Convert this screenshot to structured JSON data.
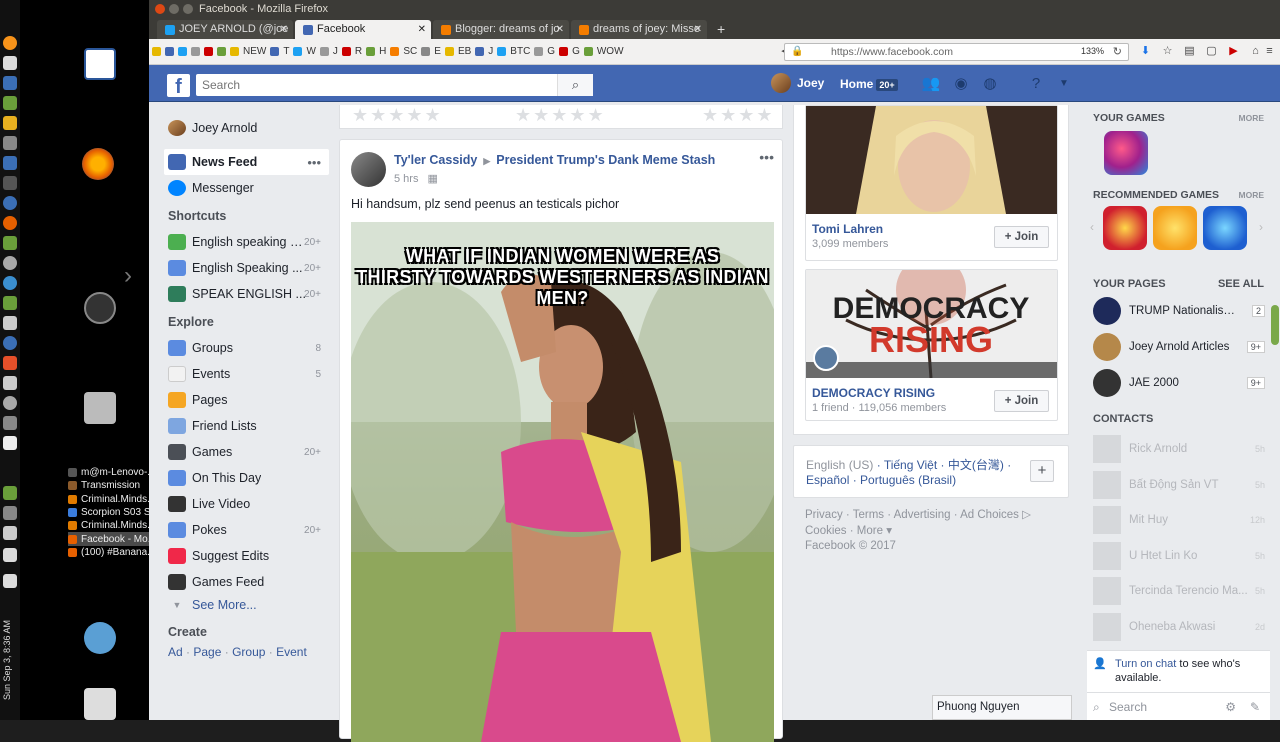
{
  "window": {
    "title": "Facebook - Mozilla Firefox"
  },
  "tabs": [
    {
      "label": "JOEY ARNOLD (@joe",
      "color": "#1da1f2"
    },
    {
      "label": "Facebook",
      "color": "#4267b2"
    },
    {
      "label": "Blogger: dreams of jo",
      "color": "#f57d00"
    },
    {
      "label": "dreams of joey: Misse",
      "color": "#f57d00"
    }
  ],
  "bookmarks": [
    "NEW",
    "T",
    "W",
    "J",
    "R",
    "H",
    "SC",
    "E",
    "EB",
    "J",
    "BTC",
    "G",
    "G",
    "WOW"
  ],
  "url": {
    "value": "https://www.facebook.com",
    "zoom": "133%"
  },
  "taskbar": [
    {
      "label": "m@m-Lenovo-...",
      "color": "#555"
    },
    {
      "label": "Transmission",
      "color": "#8b5a2b"
    },
    {
      "label": "Criminal.Minds...",
      "color": "#e07b00"
    },
    {
      "label": "Scorpion S03 S...",
      "color": "#3b7ddd"
    },
    {
      "label": "Criminal.Minds...",
      "color": "#e07b00"
    },
    {
      "label": "Facebook - Mo...",
      "color": "#e66000"
    },
    {
      "label": "(100) #Banana...",
      "color": "#e66000"
    }
  ],
  "clock": "Sun Sep 3, 8:36 AM",
  "fb": {
    "search_placeholder": "Search",
    "user_name": "Joey",
    "home_label": "Home",
    "home_badge": "20+"
  },
  "leftnav": {
    "profile": "Joey Arnold",
    "news_feed": "News Feed",
    "messenger": "Messenger",
    "shortcuts_head": "Shortcuts",
    "shortcuts": [
      {
        "label": "English speaking g...",
        "count": "20+",
        "color": "#4caf50"
      },
      {
        "label": "English Speaking ...",
        "count": "20+",
        "color": "#5b8be0"
      },
      {
        "label": "SPEAK ENGLISH ...",
        "count": "20+",
        "color": "#2e7d5b"
      }
    ],
    "explore_head": "Explore",
    "explore": [
      {
        "label": "Groups",
        "count": "8",
        "color": "#5b8be0"
      },
      {
        "label": "Events",
        "count": "5",
        "color": "#f2f2f2"
      },
      {
        "label": "Pages",
        "count": "",
        "color": "#f5a623"
      },
      {
        "label": "Friend Lists",
        "count": "",
        "color": "#7ea6e0"
      },
      {
        "label": "Games",
        "count": "20+",
        "color": "#4b4f56"
      },
      {
        "label": "On This Day",
        "count": "",
        "color": "#5b8be0"
      },
      {
        "label": "Live Video",
        "count": "",
        "color": "#333"
      },
      {
        "label": "Pokes",
        "count": "20+",
        "color": "#5b8be0"
      },
      {
        "label": "Suggest Edits",
        "count": "",
        "color": "#f02849"
      },
      {
        "label": "Games Feed",
        "count": "",
        "color": "#333"
      }
    ],
    "see_more": "See More...",
    "create_head": "Create",
    "create_links": [
      "Ad",
      "Page",
      "Group",
      "Event"
    ]
  },
  "post": {
    "author": "Ty'ler Cassidy",
    "target": "President Trump's Dank Meme Stash",
    "time": "5 hrs",
    "text": "Hi handsum, plz send peenus an testicals pichor",
    "meme_line1": "WHAT IF INDIAN WOMEN WERE AS",
    "meme_line2": "THIRSTY TOWARDS WESTERNERS AS INDIAN MEN?"
  },
  "groups": [
    {
      "name": "Tomi Lahren",
      "meta": "3,099 members",
      "join": "Join"
    },
    {
      "name": "DEMOCRACY RISING",
      "meta": "1 friend · 119,056 members",
      "join": "Join",
      "banner1": "DEMOCRACY",
      "banner2": "RISING"
    }
  ],
  "languages": {
    "current": "English (US)",
    "others1": [
      "Tiếng Việt",
      "中文(台灣)"
    ],
    "others2": [
      "Español",
      "Português (Brasil)"
    ]
  },
  "footer": {
    "line1": [
      "Privacy",
      "Terms",
      "Advertising",
      "Ad Choices"
    ],
    "line2": [
      "Cookies",
      "More"
    ],
    "copyright": "Facebook © 2017"
  },
  "right": {
    "your_games": "YOUR GAMES",
    "more1": "MORE",
    "recommended_games": "RECOMMENDED GAMES",
    "more2": "MORE",
    "your_pages": "YOUR PAGES",
    "see_all": "SEE ALL",
    "pages": [
      {
        "name": "TRUMP Nationalism ...",
        "badge": "2"
      },
      {
        "name": "Joey Arnold Articles",
        "badge": "9+"
      },
      {
        "name": "JAE 2000",
        "badge": "9+"
      }
    ],
    "contacts_head": "CONTACTS",
    "contacts": [
      {
        "name": "Rick Arnold",
        "time": "5h"
      },
      {
        "name": "Bất Động Sản VT",
        "time": "5h"
      },
      {
        "name": "Mit Huy",
        "time": "12h"
      },
      {
        "name": "U Htet Lin Ko",
        "time": "5h"
      },
      {
        "name": "Tercinda Terencio Ma...",
        "time": "5h"
      },
      {
        "name": "Oheneba Akwasi",
        "time": "2d"
      }
    ],
    "chat_link": "Turn on chat",
    "chat_rest": " to see who's available.",
    "chat_search": "Search",
    "chat_tab": "Phuong Nguyen"
  }
}
